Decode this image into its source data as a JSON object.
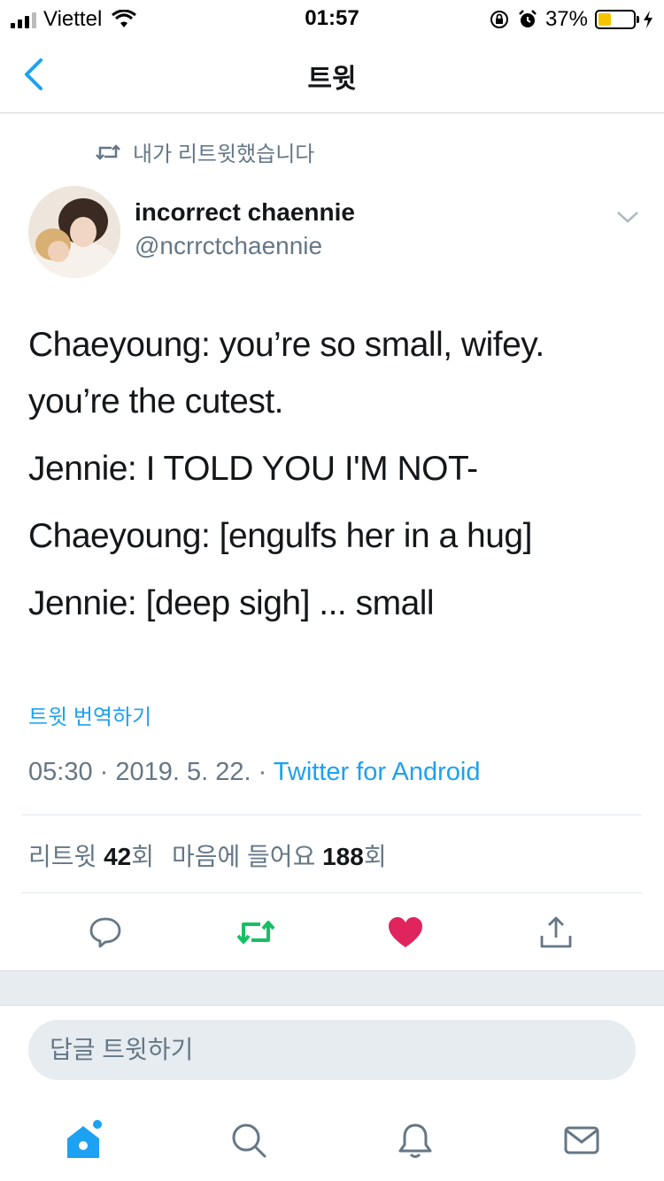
{
  "status_bar": {
    "carrier": "Viettel",
    "time": "01:57",
    "battery_percent": "37%",
    "battery_level": 0.37,
    "signal_bars": 3
  },
  "nav": {
    "title": "트윗"
  },
  "retweet_context": {
    "text": "내가 리트윗했습니다"
  },
  "author": {
    "name": "incorrect chaennie",
    "handle": "@ncrrctchaennie"
  },
  "tweet": {
    "lines": [
      "Chaeyoung: you’re so small, wifey. you’re the cutest.",
      "Jennie: I TOLD YOU I'M NOT-",
      "Chaeyoung: [engulfs her in a hug]",
      "Jennie: [deep sigh] ... small"
    ],
    "translate_label": "트윗 번역하기",
    "timestamp": "05:30 · 2019. 5. 22. · ",
    "client": "Twitter for Android"
  },
  "stats": {
    "retweet_label": "리트윗",
    "retweet_count": "42",
    "retweet_suffix": "회",
    "like_label": "마음에 들어요",
    "like_count": "188",
    "like_suffix": "회"
  },
  "actions": {
    "icons": [
      "reply-icon",
      "retweet-icon",
      "like-icon",
      "share-icon"
    ],
    "retweet_color": "#17bf63",
    "like_color": "#e0245e"
  },
  "reply": {
    "placeholder": "답글 트윗하기"
  },
  "tabbar": {
    "icons": [
      "home-icon",
      "search-icon",
      "notifications-icon",
      "messages-icon"
    ],
    "accent": "#1da1f2"
  }
}
